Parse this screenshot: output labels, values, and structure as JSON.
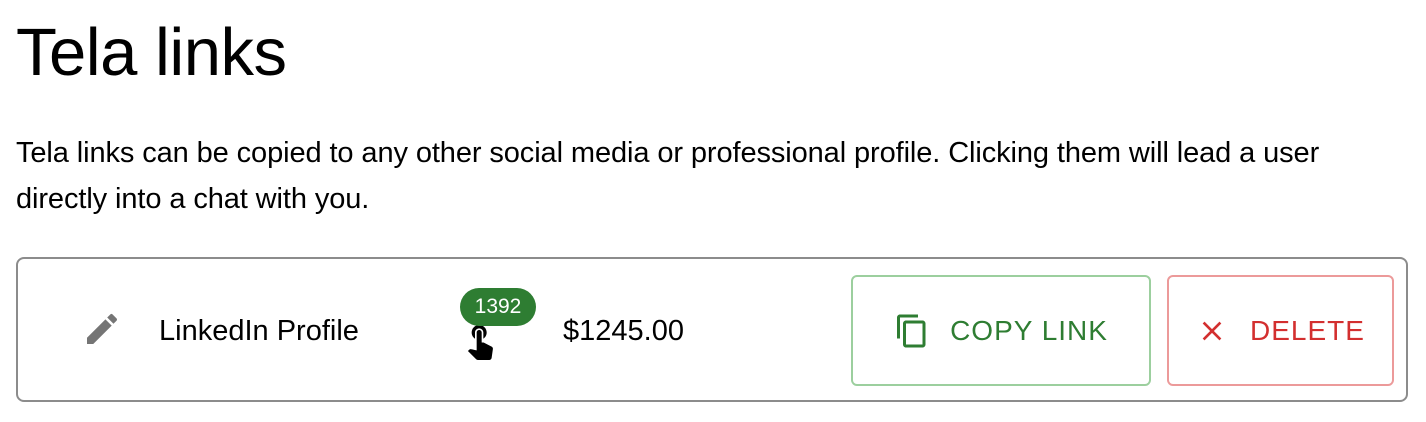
{
  "page": {
    "title": "Tela links",
    "description": "Tela links can be copied to any other social media or professional profile. Clicking them will lead a user directly into a chat with you."
  },
  "link": {
    "name": "LinkedIn Profile",
    "clicks": "1392",
    "price": "$1245.00",
    "copy_label": "COPY LINK",
    "delete_label": "DELETE"
  },
  "icons": {
    "edit": "pencil-icon",
    "clicks": "pointer-hand-icon",
    "copy": "copy-icon",
    "delete": "close-icon"
  },
  "colors": {
    "badge": "#2e7d32",
    "copy_text": "#2e7d32",
    "copy_border": "#9ccf9e",
    "delete_text": "#d32f2f",
    "delete_border": "#ec9a9a",
    "icon_gray": "#757575"
  }
}
